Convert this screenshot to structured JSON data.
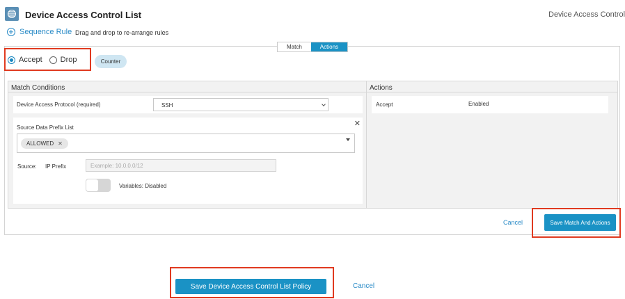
{
  "header": {
    "title": "Device Access Control List",
    "right_title": "Device Access Control Lis"
  },
  "sequence": {
    "label": "Sequence Rule",
    "hint": "Drag and drop to re-arrange rules"
  },
  "tabs": [
    {
      "label": "Match",
      "active": false
    },
    {
      "label": "Actions",
      "active": true
    }
  ],
  "radio": {
    "accept_label": "Accept",
    "drop_label": "Drop",
    "selected": "Accept"
  },
  "counter_label": "Counter",
  "match": {
    "title": "Match Conditions",
    "protocol_label": "Device Access Protocol (required)",
    "protocol_value": "SSH",
    "prefix_list_label": "Source Data Prefix List",
    "prefix_chip": "ALLOWED",
    "source_label": "Source:",
    "ip_prefix_label": "IP Prefix",
    "ip_prefix_placeholder": "Example: 10.0.0.0/12",
    "variables_label": "Variables: Disabled"
  },
  "actions": {
    "title": "Actions",
    "rows": [
      {
        "name": "Accept",
        "value": "Enabled"
      }
    ]
  },
  "footer_inner": {
    "cancel_label": "Cancel",
    "save_label": "Save Match And Actions"
  },
  "footer": {
    "save_label": "Save Device Access Control List Policy",
    "cancel_label": "Cancel"
  },
  "colors": {
    "accent": "#1a92c5",
    "highlight": "#e03a20"
  }
}
